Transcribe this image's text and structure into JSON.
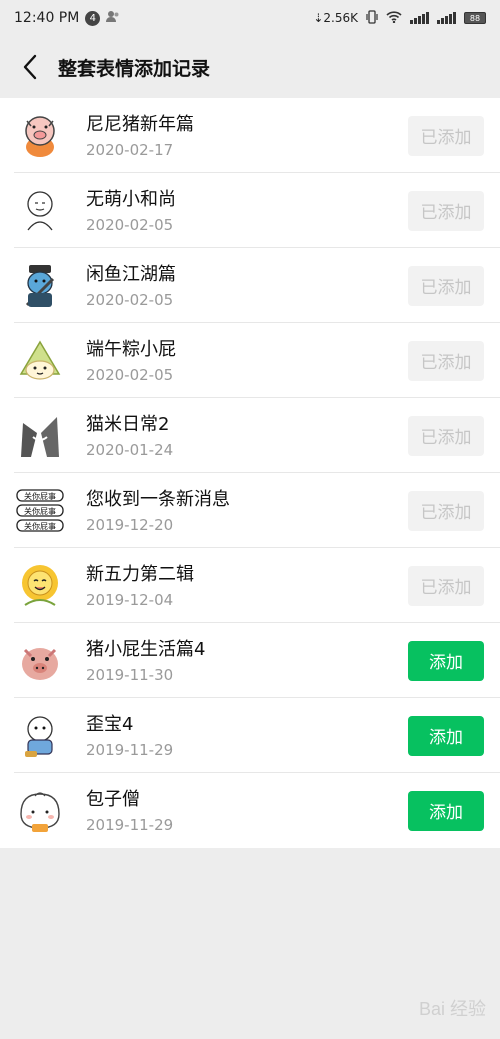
{
  "status_bar": {
    "time": "12:40 PM",
    "notification_count": "4",
    "network_speed": "2.56K",
    "battery_level": "88"
  },
  "header": {
    "title": "整套表情添加记录",
    "back_icon": "chevron-left-icon"
  },
  "items": [
    {
      "name": "尼尼猪新年篇",
      "date": "2020-02-17",
      "button": "已添加",
      "state": "added"
    },
    {
      "name": "无萌小和尚",
      "date": "2020-02-05",
      "button": "已添加",
      "state": "added"
    },
    {
      "name": "闲鱼江湖篇",
      "date": "2020-02-05",
      "button": "已添加",
      "state": "added"
    },
    {
      "name": "端午粽小屁",
      "date": "2020-02-05",
      "button": "已添加",
      "state": "added"
    },
    {
      "name": "猫米日常2",
      "date": "2020-01-24",
      "button": "已添加",
      "state": "added"
    },
    {
      "name": "您收到一条新消息",
      "date": "2019-12-20",
      "button": "已添加",
      "state": "added"
    },
    {
      "name": "新五力第二辑",
      "date": "2019-12-04",
      "button": "已添加",
      "state": "added"
    },
    {
      "name": "猪小屁生活篇4",
      "date": "2019-11-30",
      "button": "添加",
      "state": "add"
    },
    {
      "name": "歪宝4",
      "date": "2019-11-29",
      "button": "添加",
      "state": "add"
    },
    {
      "name": "包子僧",
      "date": "2019-11-29",
      "button": "添加",
      "state": "add"
    }
  ],
  "thumb_text": "关你屁事",
  "watermark": "Bai 经验",
  "colors": {
    "accent": "#07c160",
    "added_bg": "#f2f2f2",
    "added_text": "#c6c6c6"
  }
}
